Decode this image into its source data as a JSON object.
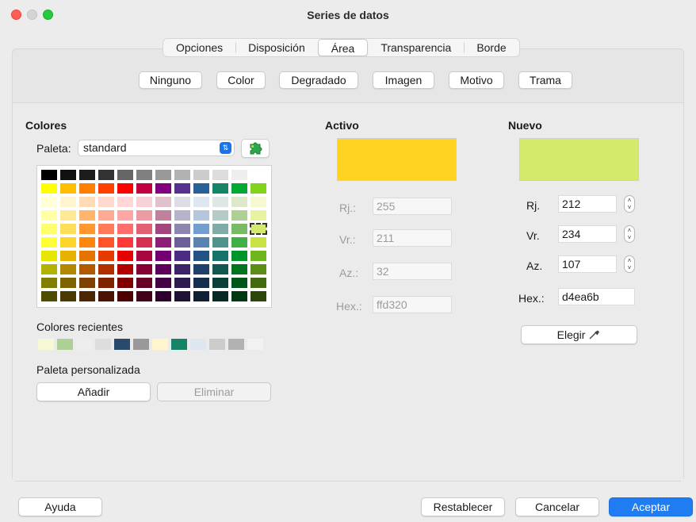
{
  "window": {
    "title": "Series de datos"
  },
  "tabs": [
    "Opciones",
    "Disposición",
    "Área",
    "Transparencia",
    "Borde"
  ],
  "active_tab": "Área",
  "fill_types": [
    "Ninguno",
    "Color",
    "Degradado",
    "Imagen",
    "Motivo",
    "Trama"
  ],
  "colors_section": {
    "heading": "Colores",
    "palette_label": "Paleta:",
    "palette_value": "standard",
    "palette_rows": [
      [
        "#000000",
        "#111111",
        "#1c1c1c",
        "#333333",
        "#666666",
        "#808080",
        "#999999",
        "#b2b2b2",
        "#cccccc",
        "#dddddd",
        "#eeeeee",
        "#ffffff"
      ],
      [
        "#ffff00",
        "#ffbf00",
        "#ff8000",
        "#ff4000",
        "#ff0000",
        "#bf0041",
        "#800080",
        "#55308d",
        "#2a6099",
        "#158466",
        "#00a933",
        "#81d41a"
      ],
      [
        "#ffffd7",
        "#fff5ce",
        "#ffdbb6",
        "#ffd8ce",
        "#ffd7d7",
        "#f7d1d5",
        "#e0c2cd",
        "#dedce6",
        "#dee6ef",
        "#dee7e5",
        "#dde8cb",
        "#f6f9d4"
      ],
      [
        "#ffffa6",
        "#ffe994",
        "#ffb66c",
        "#ffaa95",
        "#ffa6a6",
        "#ec9ba4",
        "#bf819e",
        "#b7b3ca",
        "#b4c7dc",
        "#b3cac7",
        "#afd095",
        "#e8f2a1"
      ],
      [
        "#ffff6d",
        "#ffde59",
        "#ff972f",
        "#ff7b59",
        "#ff6d6d",
        "#e16173",
        "#a1467e",
        "#8e86ae",
        "#729fcf",
        "#81aca6",
        "#77bc65",
        "#d4ea6b"
      ],
      [
        "#ffff38",
        "#ffd428",
        "#ff860d",
        "#ff5429",
        "#ff3838",
        "#d62e4e",
        "#8d1d75",
        "#6b5e9b",
        "#5983b0",
        "#50938a",
        "#3faf46",
        "#c9e243"
      ],
      [
        "#e6e600",
        "#e6b100",
        "#e67300",
        "#e63b00",
        "#e60000",
        "#a8053e",
        "#730073",
        "#4c2c82",
        "#245286",
        "#167269",
        "#00942b",
        "#6eb61b"
      ],
      [
        "#b2b200",
        "#b28800",
        "#b25900",
        "#b22f00",
        "#b20000",
        "#870033",
        "#5c005c",
        "#3c2368",
        "#1d416b",
        "#11574f",
        "#007421",
        "#5a8e16"
      ],
      [
        "#807f00",
        "#7f6200",
        "#7f3f00",
        "#7f2200",
        "#7f0000",
        "#660026",
        "#440044",
        "#2d1a4e",
        "#162f4f",
        "#0c3f3a",
        "#005519",
        "#436a0f"
      ],
      [
        "#4d4c00",
        "#4c3b00",
        "#4c2600",
        "#4c1400",
        "#4c0000",
        "#450019",
        "#2e002e",
        "#1e1234",
        "#0f1f34",
        "#082a26",
        "#003811",
        "#2d470a"
      ]
    ],
    "selected_color": "#d4ea6b",
    "recent_label": "Colores recientes",
    "recent_colors": [
      "#f6f9d4",
      "#afd095",
      "#eeeeee",
      "#dddddd",
      "#2a4a6b",
      "#999999",
      "#fff5ce",
      "#158466",
      "#dee6ef",
      "#cccccc",
      "#b2b2b2",
      "#f2f2f2"
    ],
    "custom_label": "Paleta personalizada",
    "add_label": "Añadir",
    "remove_label": "Eliminar"
  },
  "active": {
    "heading": "Activo",
    "color": "#ffd320",
    "r_label": "Rj.:",
    "r": "255",
    "g_label": "Vr.:",
    "g": "211",
    "b_label": "Az.:",
    "b": "32",
    "hex_label": "Hex.:",
    "hex": "ffd320"
  },
  "new": {
    "heading": "Nuevo",
    "color": "#d4ea6b",
    "r_label": "Rj.",
    "r": "212",
    "g_label": "Vr.",
    "g": "234",
    "b_label": "Az.",
    "b": "107",
    "hex_label": "Hex.:",
    "hex": "d4ea6b",
    "pick_label": "Elegir"
  },
  "footer": {
    "help": "Ayuda",
    "reset": "Restablecer",
    "cancel": "Cancelar",
    "ok": "Aceptar"
  }
}
